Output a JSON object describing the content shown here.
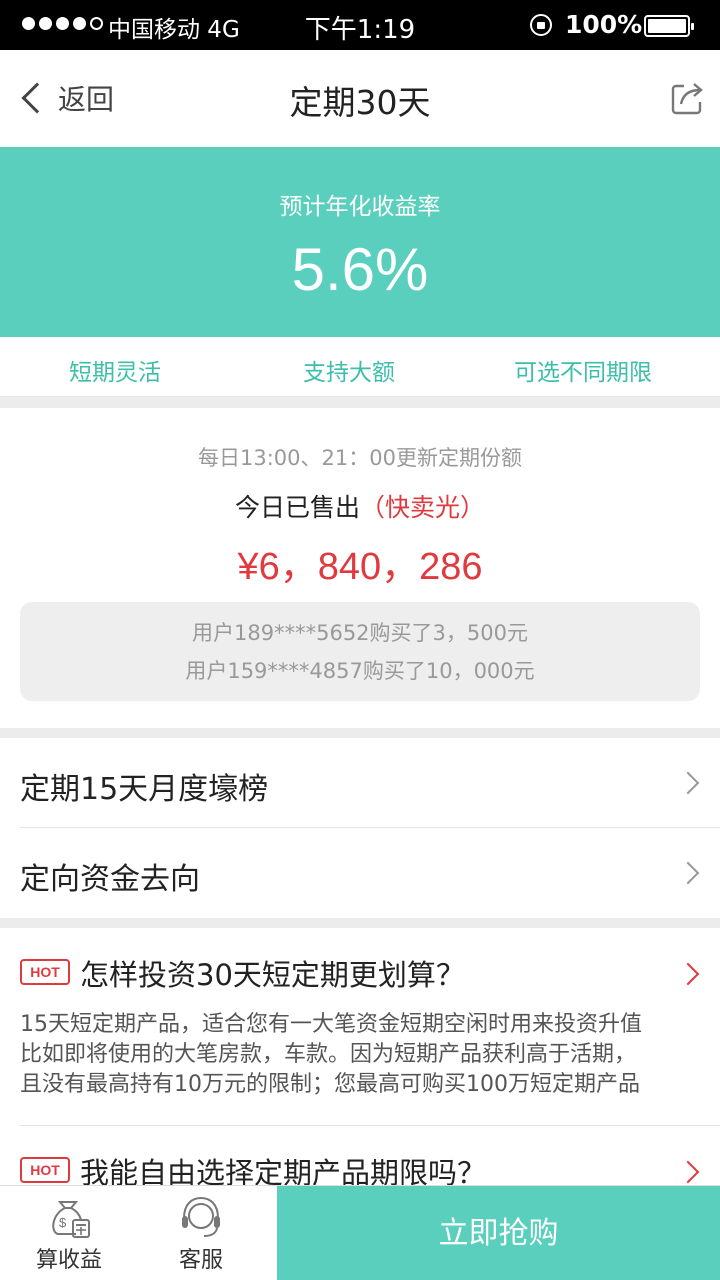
{
  "status_bar": {
    "carrier": "中国移动  4G",
    "time": "下午1:19",
    "battery": "100%"
  },
  "nav": {
    "back_label": "返回",
    "title": "定期30天"
  },
  "hero": {
    "rate_label": "预计年化收益率",
    "rate": "5.6%",
    "background": "#5bcfbd"
  },
  "tags": [
    "短期灵活",
    "支持大额",
    "可选不同期限"
  ],
  "sales": {
    "update_note": "每日13:00、21：00更新定期份额",
    "sold_label": "今日已售出",
    "sold_status": "（快卖光）",
    "amount": "¥6，840，286",
    "recent_buyers": [
      "用户189****5652购买了3，500元",
      "用户159****4857购买了10，000元"
    ]
  },
  "links": [
    {
      "label": "定期15天月度壕榜"
    },
    {
      "label": "定向资金去向"
    }
  ],
  "faq": [
    {
      "badge": "HOT",
      "question": "怎样投资30天短定期更划算？",
      "answer_lines": [
        "15天短定期产品，适合您有一大笔资金短期空闲时用来投资升值",
        "比如即将使用的大笔房款，车款。因为短期产品获利高于活期，",
        "且没有最高持有10万元的限制；您最高可购买100万短定期产品"
      ]
    },
    {
      "badge": "HOT",
      "question": "我能自由选择定期产品期限吗？"
    }
  ],
  "bottom_bar": {
    "calc_label": "算收益",
    "calc_icon": "money-bag-calculator-icon",
    "service_label": "客服",
    "service_icon": "headset-icon",
    "buy_label": "立即抢购"
  },
  "colors": {
    "accent": "#5bcfbd",
    "highlight": "#e0393e"
  }
}
